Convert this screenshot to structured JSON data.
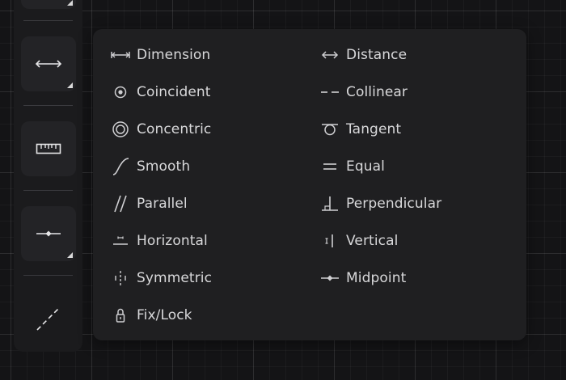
{
  "toolbar": {
    "buttons": [
      {
        "name": "dimension-tool",
        "icon": "arrows-horizontal-icon"
      },
      {
        "name": "measure-tool",
        "icon": "ruler-icon"
      },
      {
        "name": "constraint-tool",
        "icon": "midpoint-icon"
      },
      {
        "name": "construction-line-tool",
        "icon": "dashed-line-icon"
      }
    ]
  },
  "menu": {
    "items": [
      {
        "label": "Dimension",
        "icon": "dimension-icon"
      },
      {
        "label": "Distance",
        "icon": "distance-icon"
      },
      {
        "label": "Coincident",
        "icon": "coincident-icon"
      },
      {
        "label": "Collinear",
        "icon": "collinear-icon"
      },
      {
        "label": "Concentric",
        "icon": "concentric-icon"
      },
      {
        "label": "Tangent",
        "icon": "tangent-icon"
      },
      {
        "label": "Smooth",
        "icon": "smooth-icon"
      },
      {
        "label": "Equal",
        "icon": "equal-icon"
      },
      {
        "label": "Parallel",
        "icon": "parallel-icon"
      },
      {
        "label": "Perpendicular",
        "icon": "perpendicular-icon"
      },
      {
        "label": "Horizontal",
        "icon": "horizontal-icon"
      },
      {
        "label": "Vertical",
        "icon": "vertical-icon"
      },
      {
        "label": "Symmetric",
        "icon": "symmetric-icon"
      },
      {
        "label": "Midpoint",
        "icon": "midpoint-icon"
      },
      {
        "label": "Fix/Lock",
        "icon": "lock-icon"
      }
    ]
  },
  "colors": {
    "background": "#141416",
    "toolbar": "#1b1b1d",
    "button": "#232326",
    "menu": "#1f1f21",
    "text": "#d8d8da",
    "icon": "#cfcfd2"
  }
}
